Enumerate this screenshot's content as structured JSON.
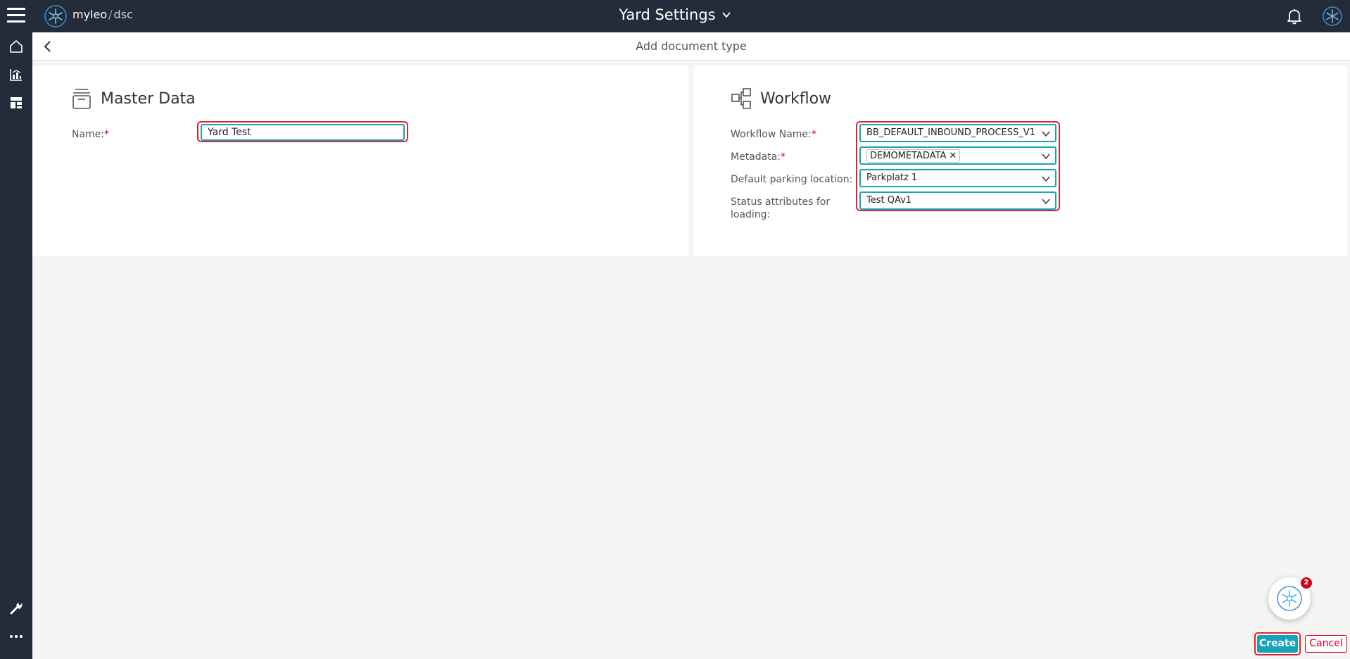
{
  "app": {
    "brand_name": "myleo",
    "brand_separator": "/",
    "brand_product": "dsc",
    "page_title": "Yard Settings"
  },
  "subheader": {
    "title": "Add document type"
  },
  "master_data": {
    "title": "Master Data",
    "name_label": "Name:",
    "required_mark": "*",
    "name_value": "Yard Test"
  },
  "workflow": {
    "title": "Workflow",
    "required_mark": "*",
    "workflow_name_label": "Workflow Name:",
    "workflow_name_value": "BB_DEFAULT_INBOUND_PROCESS_V1",
    "metadata_label": "Metadata:",
    "metadata_tag": "DEMOMETADATA",
    "tag_remove": "✕",
    "parking_label": "Default parking location:",
    "parking_value": "Parkplatz 1",
    "status_label_line1": "Status attributes for",
    "status_label_line2": "loading:",
    "status_value": "Test QAv1"
  },
  "assistant": {
    "badge_count": "2"
  },
  "actions": {
    "create_label": "Create",
    "cancel_label": "Cancel"
  },
  "icons": {
    "menu": "hamburger-icon",
    "logo": "snowflake-logo",
    "bell": "bell-icon",
    "home": "home-icon",
    "analytics": "chart-icon",
    "dashboard": "dashboard-icon",
    "tools": "wrench-icon",
    "more": "more-icon",
    "back": "chevron-left-icon",
    "master": "archive-box-icon",
    "workflow": "workflow-icon"
  },
  "colors": {
    "topbar": "#232c38",
    "accent": "#17a2b8",
    "highlight": "#e0262b",
    "required": "#d0021b"
  }
}
